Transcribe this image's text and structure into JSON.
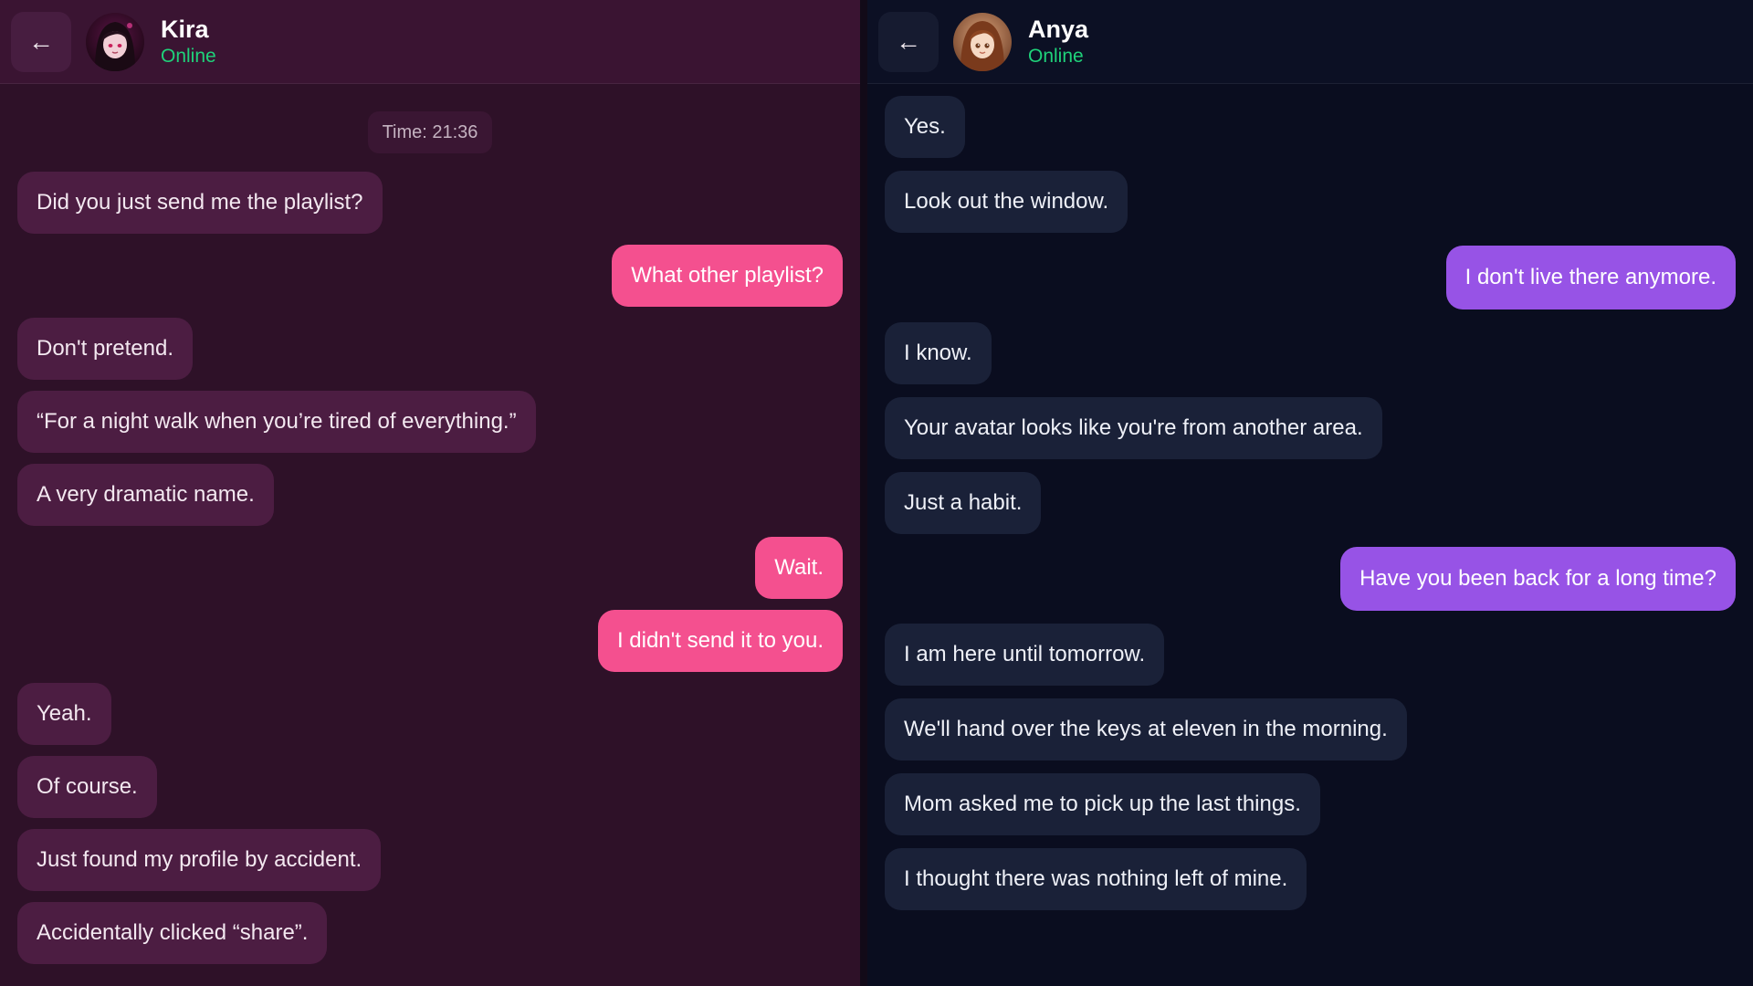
{
  "left": {
    "contact": {
      "name": "Kira",
      "status": "Online"
    },
    "back_glyph": "←",
    "time_label": "Time: 21:36",
    "colors": {
      "bg": "#2e1128",
      "incoming": "#4c1d42",
      "outgoing": "#f4508f",
      "online": "#1fd27a"
    },
    "messages": [
      {
        "dir": "in",
        "text": "Did you just send me the playlist?"
      },
      {
        "dir": "out",
        "text": "What other playlist?"
      },
      {
        "dir": "in",
        "text": "Don't pretend."
      },
      {
        "dir": "in",
        "text": "“For a night walk when you’re tired of everything.”"
      },
      {
        "dir": "in",
        "text": "A very dramatic name."
      },
      {
        "dir": "out",
        "text": "Wait."
      },
      {
        "dir": "out",
        "text": "I didn't send it to you."
      },
      {
        "dir": "in",
        "text": "Yeah."
      },
      {
        "dir": "in",
        "text": "Of course."
      },
      {
        "dir": "in",
        "text": "Just found my profile by accident."
      },
      {
        "dir": "in",
        "text": "Accidentally clicked “share”."
      }
    ]
  },
  "right": {
    "contact": {
      "name": "Anya",
      "status": "Online"
    },
    "back_glyph": "←",
    "colors": {
      "bg": "#0a0d1f",
      "incoming": "#1a2138",
      "outgoing": "#9753e6",
      "online": "#1fd27a"
    },
    "messages": [
      {
        "dir": "in",
        "text": "Yes."
      },
      {
        "dir": "in",
        "text": "Look out the window."
      },
      {
        "dir": "out",
        "text": "I don't live there anymore."
      },
      {
        "dir": "in",
        "text": "I know."
      },
      {
        "dir": "in",
        "text": "Your avatar looks like you're from another area."
      },
      {
        "dir": "in",
        "text": "Just a habit."
      },
      {
        "dir": "out",
        "text": "Have you been back for a long time?"
      },
      {
        "dir": "in",
        "text": "I am here until tomorrow."
      },
      {
        "dir": "in",
        "text": "We'll hand over the keys at eleven in the morning."
      },
      {
        "dir": "in",
        "text": "Mom asked me to pick up the last things."
      },
      {
        "dir": "in",
        "text": "I thought there was nothing left of mine."
      }
    ]
  }
}
